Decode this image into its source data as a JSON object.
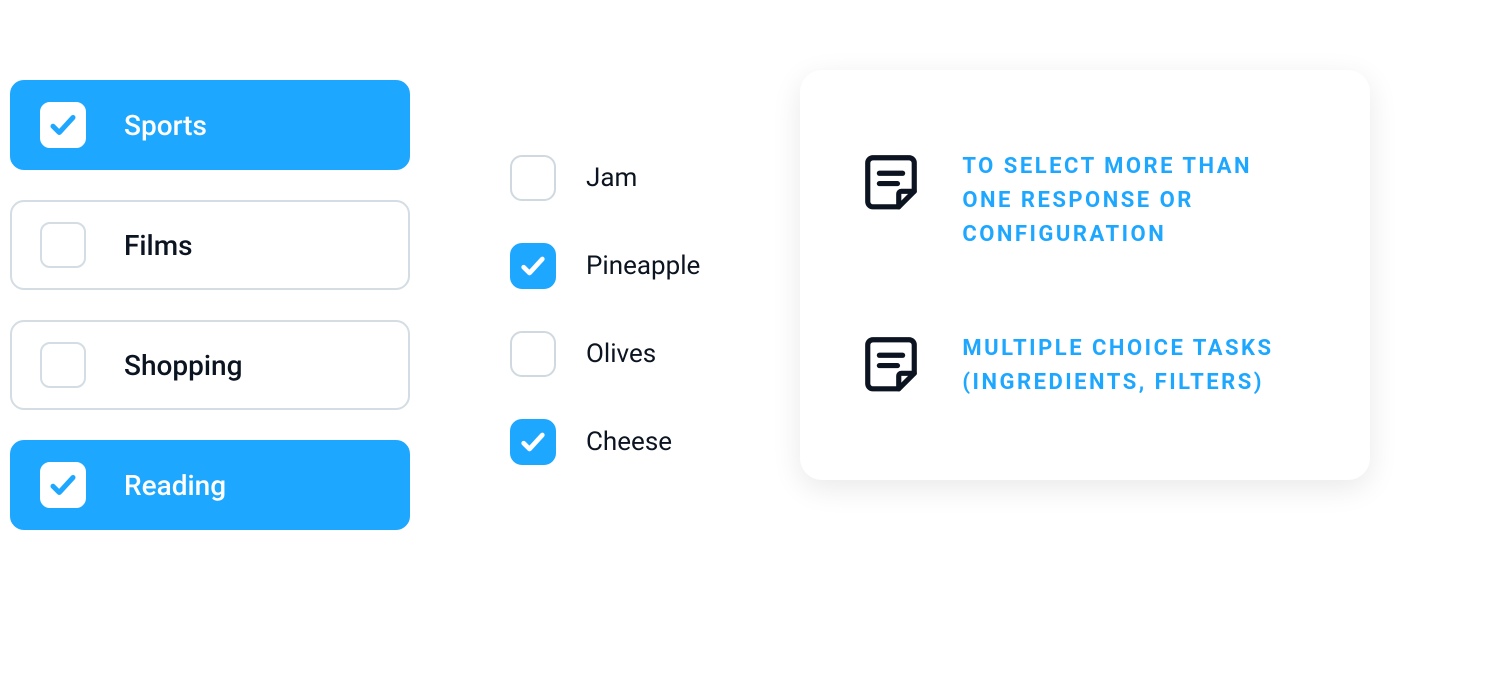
{
  "col1": {
    "items": [
      {
        "label": "Sports",
        "checked": true
      },
      {
        "label": "Films",
        "checked": false
      },
      {
        "label": "Shopping",
        "checked": false
      },
      {
        "label": "Reading",
        "checked": true
      }
    ]
  },
  "col2": {
    "items": [
      {
        "label": "Jam",
        "checked": false
      },
      {
        "label": "Pineapple",
        "checked": true
      },
      {
        "label": "Olives",
        "checked": false
      },
      {
        "label": "Cheese",
        "checked": true
      }
    ]
  },
  "info": {
    "items": [
      {
        "text": "To select more than one response or configuration"
      },
      {
        "text": "Multiple choice tasks (ingredients, filters)"
      }
    ]
  }
}
